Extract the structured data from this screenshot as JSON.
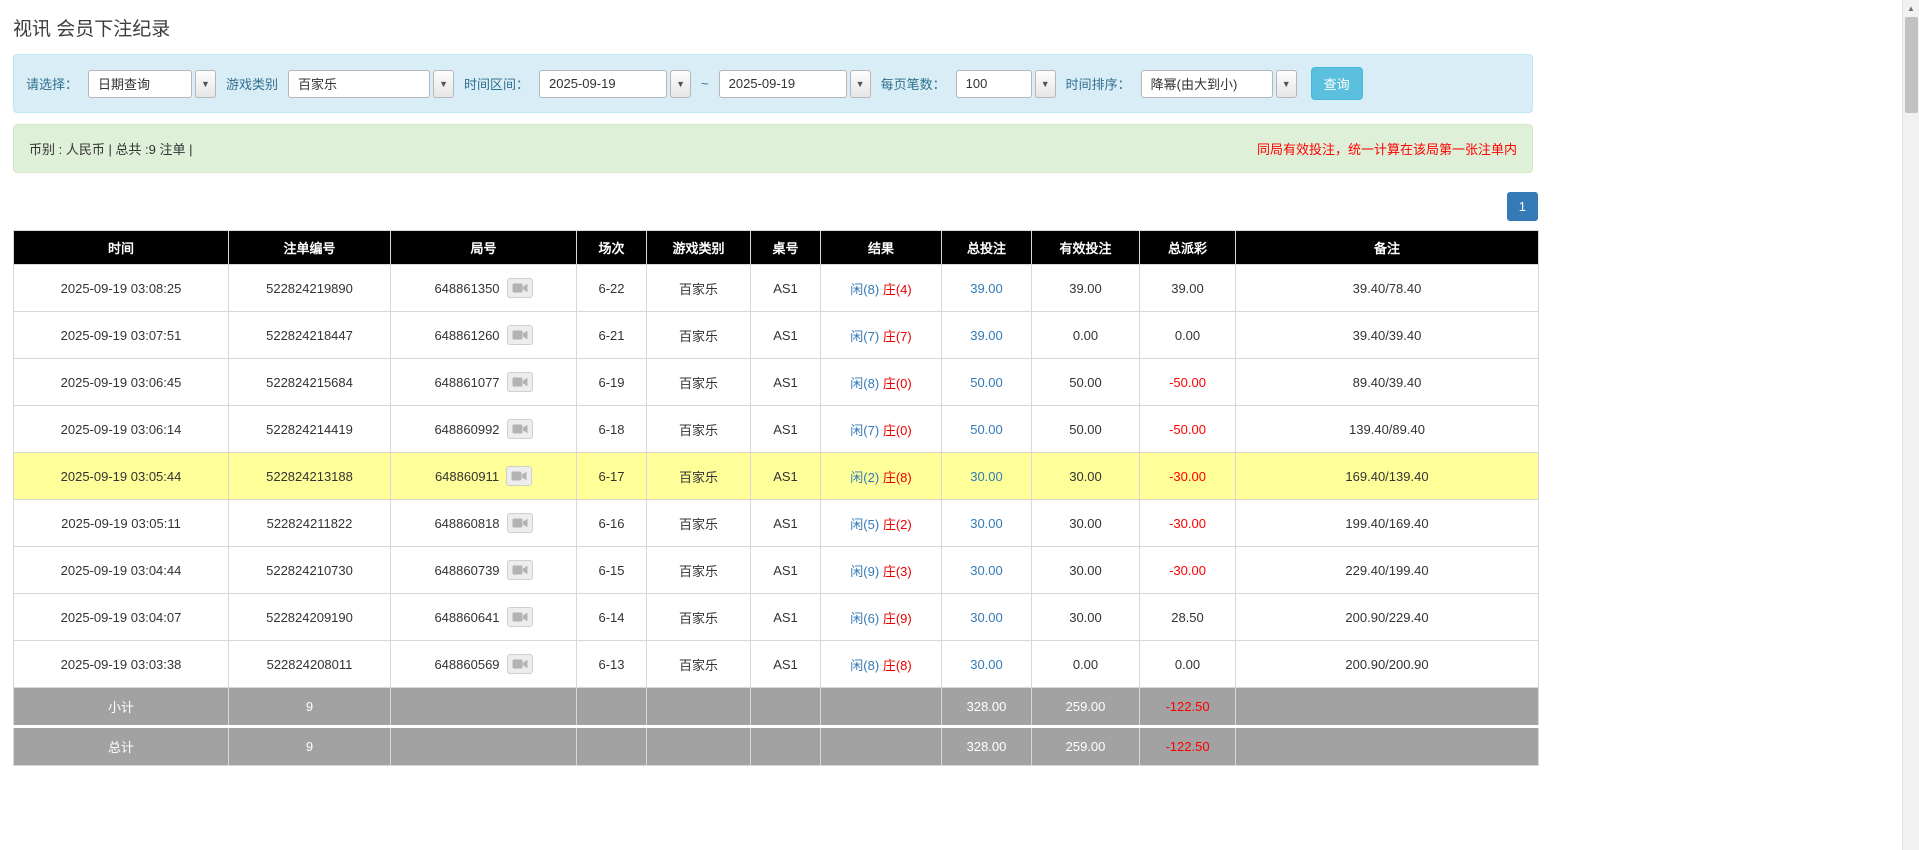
{
  "page": {
    "title": "视讯 会员下注纪录"
  },
  "filter": {
    "select_label": "请选择：",
    "select_value": "日期查询",
    "game_label": "游戏类别",
    "game_value": "百家乐",
    "range_label": "时间区间：",
    "date_from": "2025-09-19",
    "range_separator": "~",
    "date_to": "2025-09-19",
    "page_size_label": "每页笔数：",
    "page_size_value": "100",
    "sort_label": "时间排序：",
    "sort_value": "降幂(由大到小)",
    "search_label": "查询"
  },
  "summary": {
    "currency_info": "币别 : 人民币 | 总共 :9 注单 |",
    "notice": "同局有效投注，统一计算在该局第一张注单内"
  },
  "pagination": {
    "page_1": "1"
  },
  "table": {
    "headers": [
      "时间",
      "注单编号",
      "局号",
      "场次",
      "游戏类别",
      "桌号",
      "结果",
      "总投注",
      "有效投注",
      "总派彩",
      "备注"
    ],
    "rows": [
      {
        "time": "2025-09-19 03:08:25",
        "bet_id": "522824219890",
        "round_id": "648861350",
        "session": "6-22",
        "game": "百家乐",
        "table_no": "AS1",
        "result_player": "闲(8)",
        "result_banker": "庄(4)",
        "total_bet": "39.00",
        "valid_bet": "39.00",
        "payout": "39.00",
        "note": "39.40/78.40",
        "highlight": false
      },
      {
        "time": "2025-09-19 03:07:51",
        "bet_id": "522824218447",
        "round_id": "648861260",
        "session": "6-21",
        "game": "百家乐",
        "table_no": "AS1",
        "result_player": "闲(7)",
        "result_banker": "庄(7)",
        "total_bet": "39.00",
        "valid_bet": "0.00",
        "payout": "0.00",
        "note": "39.40/39.40",
        "highlight": false
      },
      {
        "time": "2025-09-19 03:06:45",
        "bet_id": "522824215684",
        "round_id": "648861077",
        "session": "6-19",
        "game": "百家乐",
        "table_no": "AS1",
        "result_player": "闲(8)",
        "result_banker": "庄(0)",
        "total_bet": "50.00",
        "valid_bet": "50.00",
        "payout": "-50.00",
        "note": "89.40/39.40",
        "highlight": false
      },
      {
        "time": "2025-09-19 03:06:14",
        "bet_id": "522824214419",
        "round_id": "648860992",
        "session": "6-18",
        "game": "百家乐",
        "table_no": "AS1",
        "result_player": "闲(7)",
        "result_banker": "庄(0)",
        "total_bet": "50.00",
        "valid_bet": "50.00",
        "payout": "-50.00",
        "note": "139.40/89.40",
        "highlight": false
      },
      {
        "time": "2025-09-19 03:05:44",
        "bet_id": "522824213188",
        "round_id": "648860911",
        "session": "6-17",
        "game": "百家乐",
        "table_no": "AS1",
        "result_player": "闲(2)",
        "result_banker": "庄(8)",
        "total_bet": "30.00",
        "valid_bet": "30.00",
        "payout": "-30.00",
        "note": "169.40/139.40",
        "highlight": true
      },
      {
        "time": "2025-09-19 03:05:11",
        "bet_id": "522824211822",
        "round_id": "648860818",
        "session": "6-16",
        "game": "百家乐",
        "table_no": "AS1",
        "result_player": "闲(5)",
        "result_banker": "庄(2)",
        "total_bet": "30.00",
        "valid_bet": "30.00",
        "payout": "-30.00",
        "note": "199.40/169.40",
        "highlight": false
      },
      {
        "time": "2025-09-19 03:04:44",
        "bet_id": "522824210730",
        "round_id": "648860739",
        "session": "6-15",
        "game": "百家乐",
        "table_no": "AS1",
        "result_player": "闲(9)",
        "result_banker": "庄(3)",
        "total_bet": "30.00",
        "valid_bet": "30.00",
        "payout": "-30.00",
        "note": "229.40/199.40",
        "highlight": false
      },
      {
        "time": "2025-09-19 03:04:07",
        "bet_id": "522824209190",
        "round_id": "648860641",
        "session": "6-14",
        "game": "百家乐",
        "table_no": "AS1",
        "result_player": "闲(6)",
        "result_banker": "庄(9)",
        "total_bet": "30.00",
        "valid_bet": "30.00",
        "payout": "28.50",
        "note": "200.90/229.40",
        "highlight": false
      },
      {
        "time": "2025-09-19 03:03:38",
        "bet_id": "522824208011",
        "round_id": "648860569",
        "session": "6-13",
        "game": "百家乐",
        "table_no": "AS1",
        "result_player": "闲(8)",
        "result_banker": "庄(8)",
        "total_bet": "30.00",
        "valid_bet": "0.00",
        "payout": "0.00",
        "note": "200.90/200.90",
        "highlight": false
      }
    ],
    "subtotal": {
      "label": "小计",
      "count": "9",
      "total_bet": "328.00",
      "valid_bet": "259.00",
      "payout": "-122.50"
    },
    "total": {
      "label": "总计",
      "count": "9",
      "total_bet": "328.00",
      "valid_bet": "259.00",
      "payout": "-122.50"
    }
  },
  "colors": {
    "accent_blue": "#337ab7",
    "banker_red": "#e60000",
    "negative_red": "#ff0000",
    "header_black": "#010101",
    "highlight_yellow": "#ffff99"
  }
}
